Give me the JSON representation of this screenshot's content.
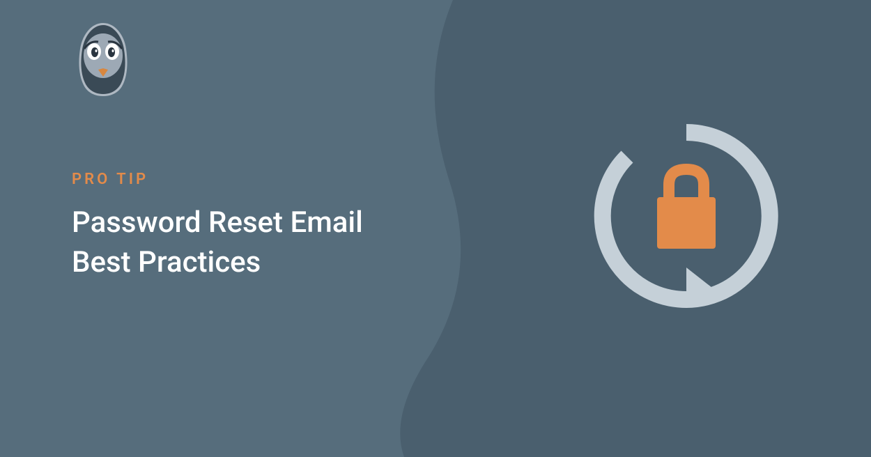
{
  "eyebrow": "PRO TIP",
  "title_line1": "Password Reset Email",
  "title_line2": "Best Practices",
  "colors": {
    "background_left": "#566d7c",
    "background_right": "#4a5f6e",
    "accent": "#e38b4a",
    "text": "#ffffff",
    "icon_stroke": "#c5d0d8"
  },
  "icons": {
    "logo": "pigeon-mascot",
    "main": "lock-reset"
  }
}
